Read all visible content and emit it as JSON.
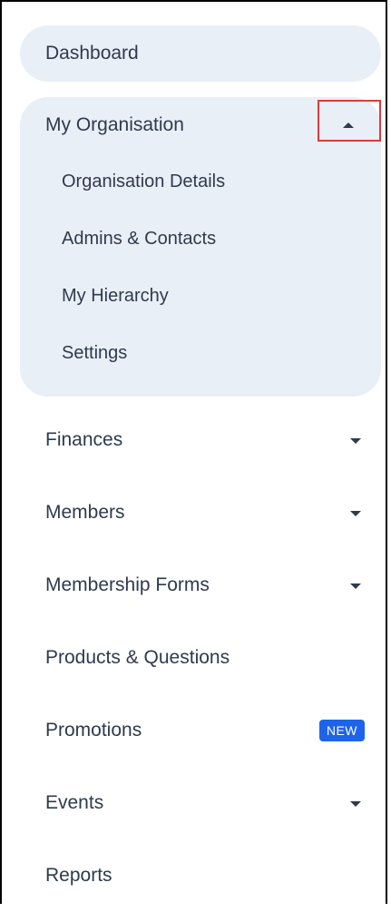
{
  "nav": {
    "dashboard": "Dashboard",
    "my_organisation": {
      "label": "My Organisation",
      "expanded": true,
      "children": [
        "Organisation Details",
        "Admins & Contacts",
        "My Hierarchy",
        "Settings"
      ]
    },
    "items": [
      {
        "label": "Finances",
        "has_caret": true
      },
      {
        "label": "Members",
        "has_caret": true
      },
      {
        "label": "Membership Forms",
        "has_caret": true
      },
      {
        "label": "Products & Questions",
        "has_caret": false
      },
      {
        "label": "Promotions",
        "badge": "NEW"
      },
      {
        "label": "Events",
        "has_caret": true
      },
      {
        "label": "Reports",
        "has_caret": false
      }
    ]
  },
  "colors": {
    "active_bg": "#e9eff7",
    "text": "#2f3a4d",
    "badge": "#1e63e9",
    "highlight_box": "#e0393a"
  }
}
